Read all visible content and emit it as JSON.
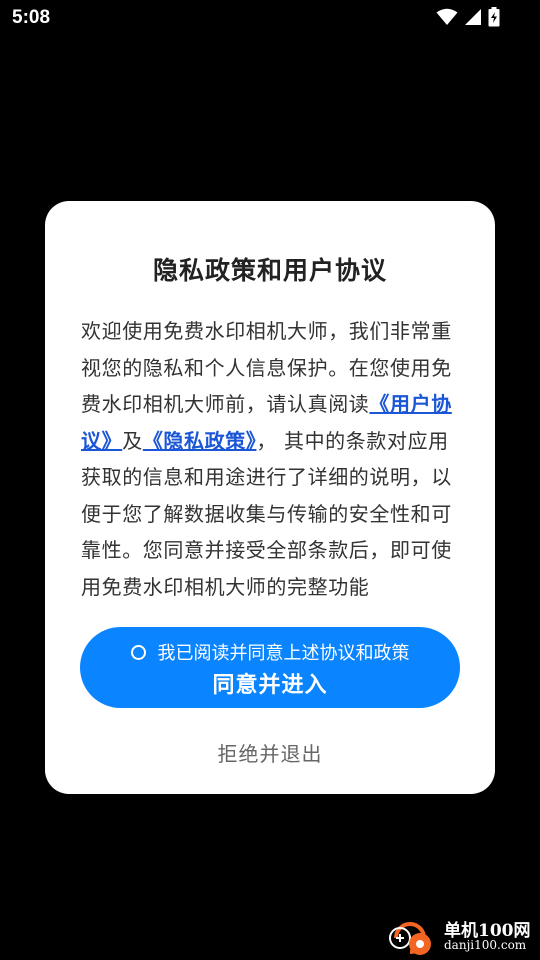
{
  "status_bar": {
    "time": "5:08",
    "icons": [
      "wifi-icon",
      "signal-icon",
      "battery-charging-icon"
    ]
  },
  "dialog": {
    "title": "隐私政策和用户协议",
    "body": {
      "part1": "欢迎使用免费水印相机大师，我们非常重视您的隐私和个人信息保护。在您使用免费水印相机大师前，请认真阅读",
      "user_agreement_link": "《用户协议》",
      "conjunction": "及",
      "privacy_policy_link": "《隐私政策》",
      "part2": "， 其中的条款对应用获取的信息和用途进行了详细的说明，以便于您了解数据收集与传输的安全性和可靠性。您同意并接受全部条款后，即可使用免费水印相机大师的完整功能"
    },
    "consent_text": "我已阅读并同意上述协议和政策",
    "agree_label": "同意并进入",
    "reject_label": "拒绝并退出"
  },
  "watermark": {
    "name": "单机100网",
    "url": "danji100.com"
  },
  "colors": {
    "primary": "#0a84ff",
    "link": "#1a56d6",
    "background": "#000000",
    "dialog": "#ffffff"
  }
}
